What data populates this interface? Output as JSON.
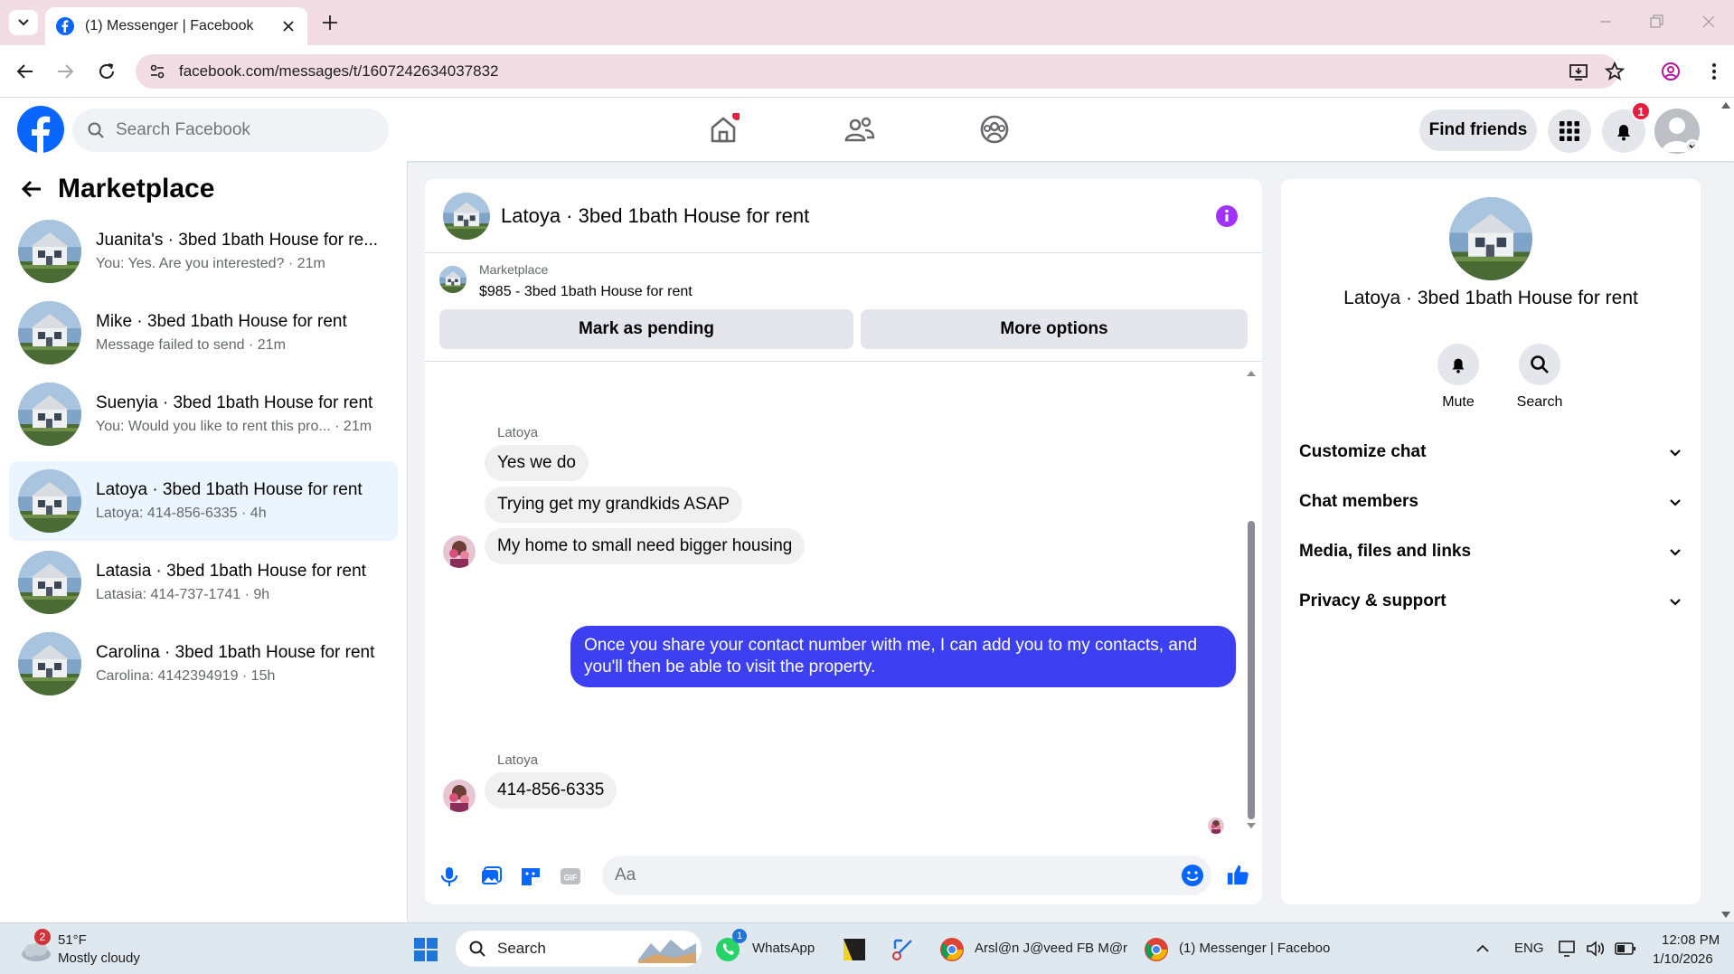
{
  "browser": {
    "tab_title": "(1) Messenger | Facebook",
    "url": "facebook.com/messages/t/1607242634037832"
  },
  "fb_header": {
    "search_placeholder": "Search Facebook",
    "find_friends": "Find friends",
    "notification_count": "1"
  },
  "left_panel": {
    "title": "Marketplace",
    "conversations": [
      {
        "name": "Juanita's · 3bed 1bath House for re...",
        "preview": "You: Yes. Are you interested? · 21m"
      },
      {
        "name": "Mike · 3bed 1bath House for rent",
        "preview": "Message failed to send · 21m"
      },
      {
        "name": "Suenyia · 3bed 1bath House for rent",
        "preview": "You: Would you like to rent this pro... · 21m"
      },
      {
        "name": "Latoya · 3bed 1bath House for rent",
        "preview": "Latoya: 414-856-6335 · 4h"
      },
      {
        "name": "Latasia · 3bed 1bath House for rent",
        "preview": "Latasia: 414-737-1741 · 9h"
      },
      {
        "name": "Carolina · 3bed 1bath House for rent",
        "preview": "Carolina: 4142394919 · 15h"
      }
    ]
  },
  "chat": {
    "title": "Latoya · 3bed 1bath House for rent",
    "listing_label": "Marketplace",
    "listing_price": "$985 - 3bed 1bath House for rent",
    "mark_pending": "Mark as pending",
    "more_options": "More options",
    "sender_name": "Latoya",
    "messages_in_1": [
      "Yes we do",
      "Trying get my grandkids ASAP",
      "My home to small need bigger housing"
    ],
    "message_out": "Once you share your contact number with me, I can add you to my contacts, and you'll then be able to visit the property.",
    "message_in_2": "414-856-6335",
    "input_placeholder": "Aa"
  },
  "right_panel": {
    "title": "Latoya · 3bed 1bath House for rent",
    "mute": "Mute",
    "search": "Search",
    "sections": [
      "Customize chat",
      "Chat members",
      "Media, files and links",
      "Privacy & support"
    ]
  },
  "taskbar": {
    "weather_temp": "51°F",
    "weather_desc": "Mostly cloudy",
    "weather_badge": "2",
    "search_label": "Search",
    "whatsapp": "WhatsApp",
    "whatsapp_badge": "1",
    "chrome_profile1": "Arsl@n J@veed FB M@r",
    "chrome_profile2": "(1) Messenger | Faceboo",
    "lang": "ENG",
    "time": "12:08 PM",
    "date": "1/10/2026"
  },
  "colors": {
    "fb_blue": "#0866ff",
    "outgoing_bubble": "#3d40f2",
    "messenger_purple": "#a033ff",
    "tab_strip": "#f3dde4"
  }
}
